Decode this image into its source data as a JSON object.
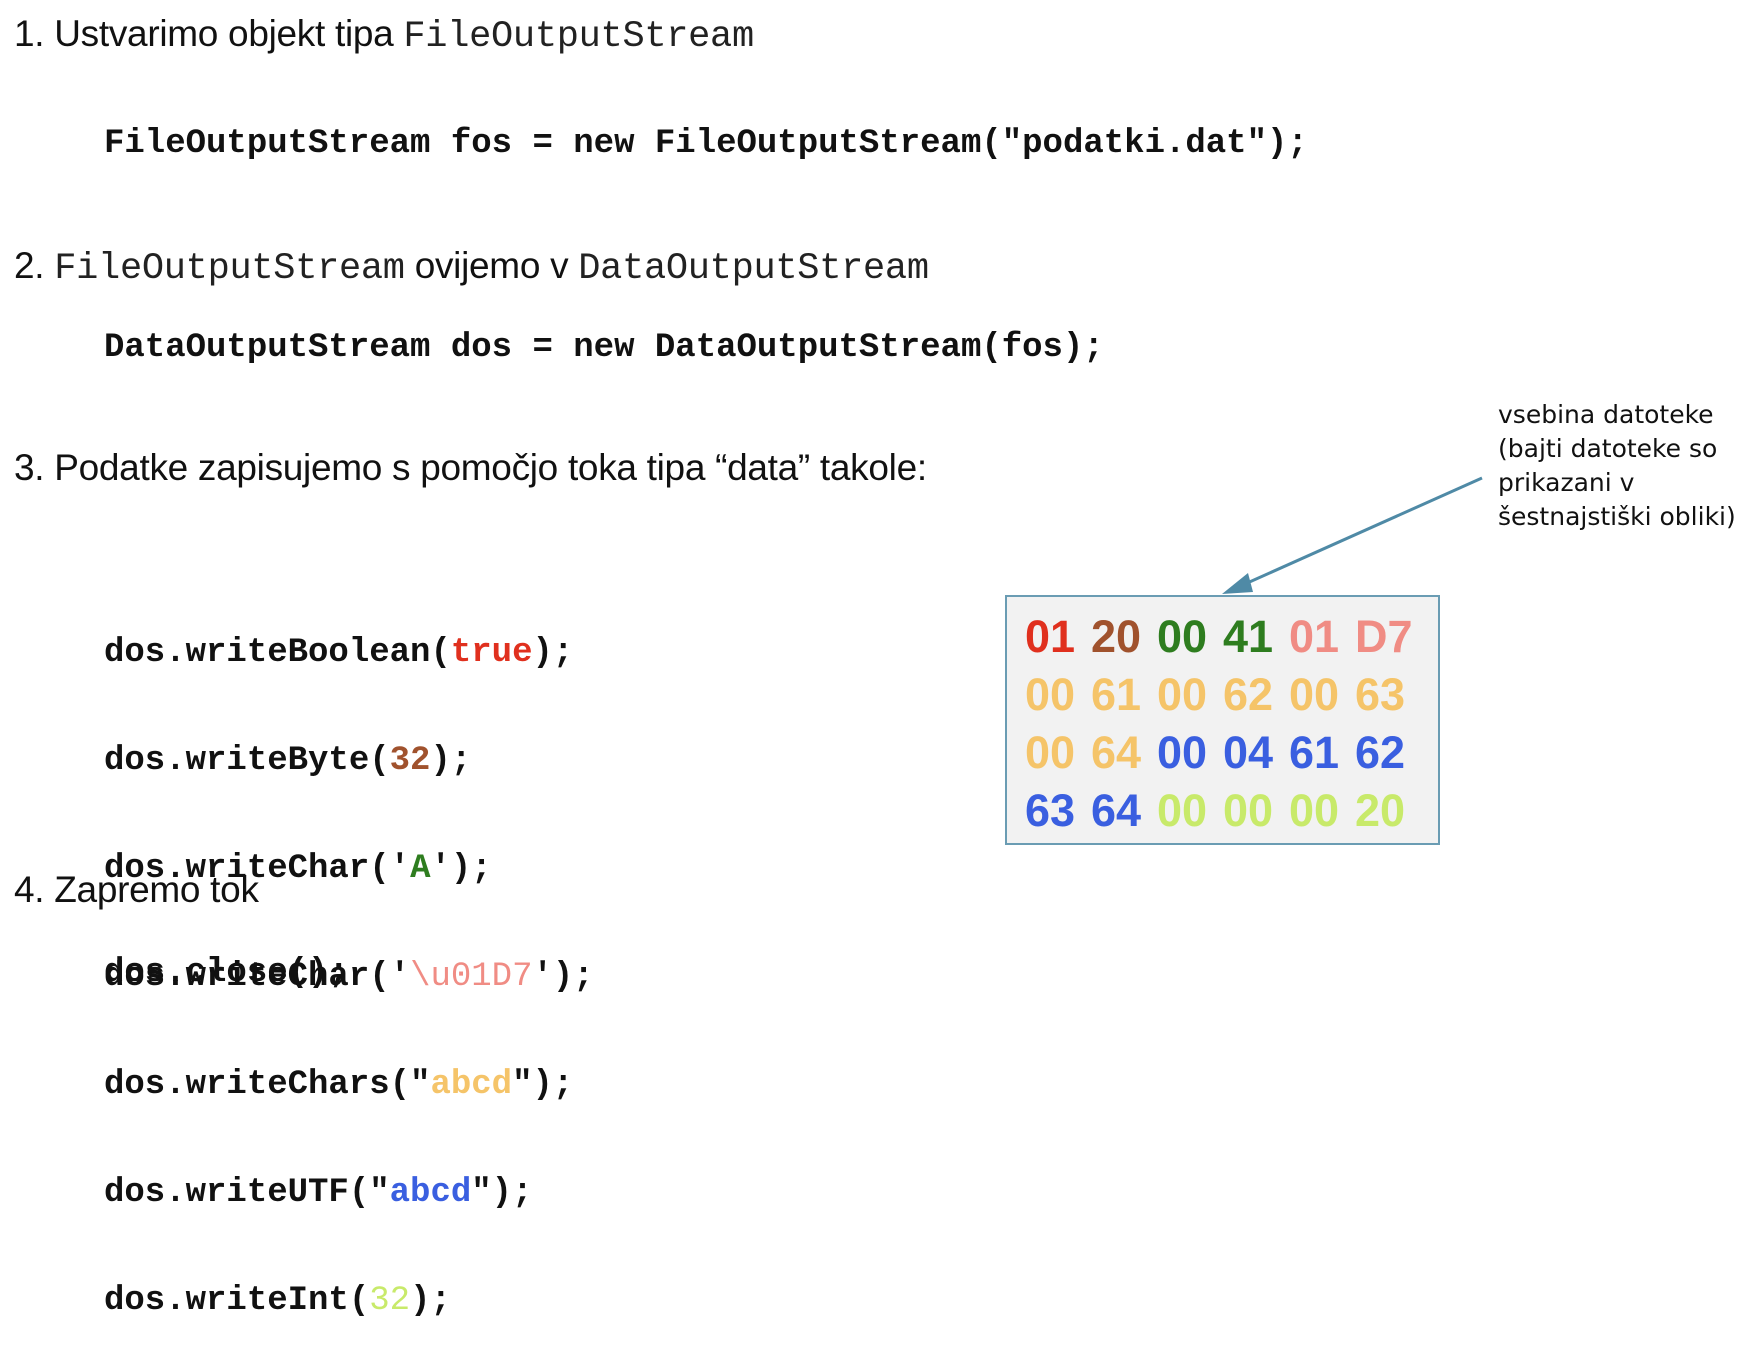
{
  "colors": {
    "boolean": "#e0301e",
    "byte": "#a0522d",
    "char_a": "#2e7d1f",
    "char_u": "#f08c84",
    "chars": "#f5c469",
    "utf": "#3a5fe0",
    "int": "#c8ea6a",
    "arrow": "#4f8aa6"
  },
  "steps": [
    {
      "num": "1.",
      "text": "Ustvarimo objekt tipa",
      "code": "FileOutputStream"
    },
    {
      "num": "2.",
      "code1": "FileOutputStream",
      "mid": "ovijemo v",
      "code2": "DataOutputStream"
    },
    {
      "num": "3.",
      "text": "Podatke zapisujemo s pomočjo toka tipa “data” takole:"
    },
    {
      "num": "4.",
      "text": "Zapremo tok"
    }
  ],
  "code": {
    "step1": "FileOutputStream fos = new FileOutputStream(\"podatki.dat\");",
    "step2": "DataOutputStream dos = new DataOutputStream(fos);",
    "step3": [
      {
        "pre": "dos.writeBoolean(",
        "arg": "true",
        "post": ");",
        "color": "boolean"
      },
      {
        "pre": "dos.writeByte(",
        "arg": "32",
        "post": ");",
        "color": "byte"
      },
      {
        "pre": "dos.writeChar('",
        "arg": "A",
        "post": "');",
        "color": "char_a"
      },
      {
        "pre": "dos.writeChar('",
        "arg": "\\u01D7",
        "post": "');",
        "color": "char_u"
      },
      {
        "pre": "dos.writeChars(\"",
        "arg": "abcd",
        "post": "\");",
        "color": "chars"
      },
      {
        "pre": "dos.writeUTF(\"",
        "arg": "abcd",
        "post": "\");",
        "color": "utf"
      },
      {
        "pre": "dos.writeInt(",
        "arg": "32",
        "post": ");",
        "color": "int"
      }
    ],
    "step4": "dos.close();"
  },
  "annotation": {
    "lines": [
      "vsebina datoteke",
      "(bajti datoteke so",
      "prikazani v",
      "šestnajstiški  obliki)"
    ]
  },
  "hex_rows": [
    [
      {
        "v": "01",
        "c": "boolean"
      },
      {
        "v": "20",
        "c": "byte"
      },
      {
        "v": "00",
        "c": "char_a"
      },
      {
        "v": "41",
        "c": "char_a"
      },
      {
        "v": "01",
        "c": "char_u"
      },
      {
        "v": "D7",
        "c": "char_u"
      }
    ],
    [
      {
        "v": "00",
        "c": "chars"
      },
      {
        "v": "61",
        "c": "chars"
      },
      {
        "v": "00",
        "c": "chars"
      },
      {
        "v": "62",
        "c": "chars"
      },
      {
        "v": "00",
        "c": "chars"
      },
      {
        "v": "63",
        "c": "chars"
      }
    ],
    [
      {
        "v": "00",
        "c": "chars"
      },
      {
        "v": "64",
        "c": "chars"
      },
      {
        "v": "00",
        "c": "utf"
      },
      {
        "v": "04",
        "c": "utf"
      },
      {
        "v": "61",
        "c": "utf"
      },
      {
        "v": "62",
        "c": "utf"
      }
    ],
    [
      {
        "v": "63",
        "c": "utf"
      },
      {
        "v": "64",
        "c": "utf"
      },
      {
        "v": "00",
        "c": "int"
      },
      {
        "v": "00",
        "c": "int"
      },
      {
        "v": "00",
        "c": "int"
      },
      {
        "v": "20",
        "c": "int"
      }
    ]
  ]
}
